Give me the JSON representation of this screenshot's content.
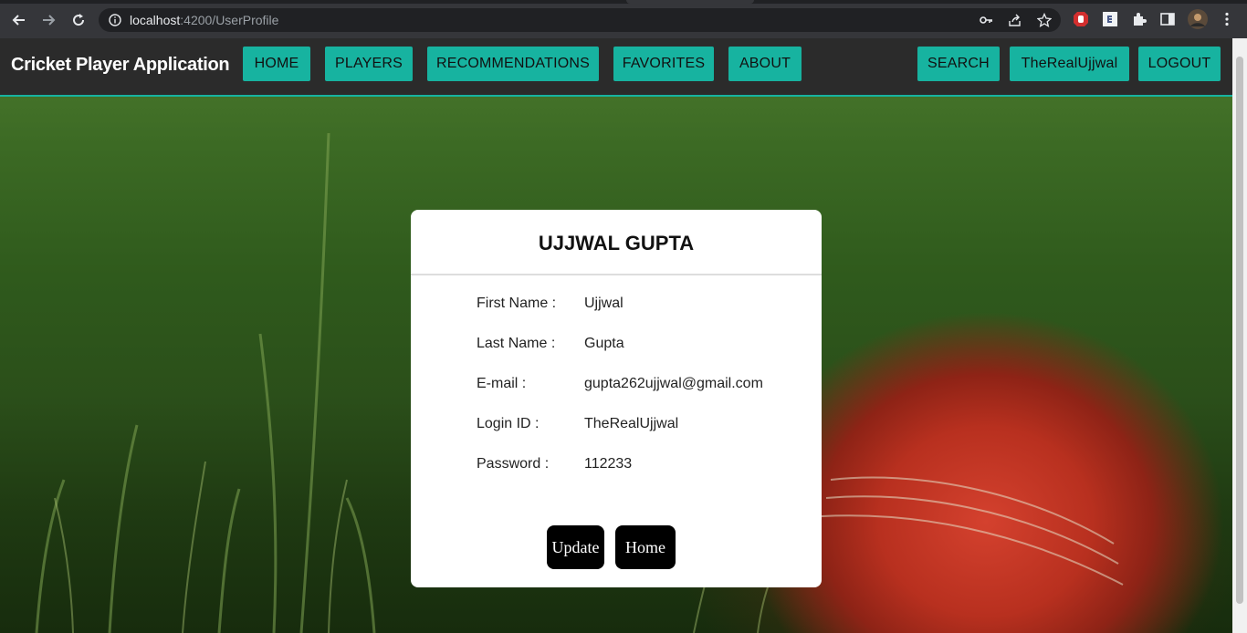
{
  "browser": {
    "url_host": "localhost",
    "url_path": ":4200/UserProfile"
  },
  "navbar": {
    "brand": "Cricket Player Application",
    "links": [
      "HOME",
      "PLAYERS",
      "RECOMMENDATIONS",
      "FAVORITES",
      "ABOUT"
    ],
    "right_links": [
      "SEARCH",
      "TheRealUjjwal",
      "LOGOUT"
    ]
  },
  "profile": {
    "title": "UJJWAL GUPTA",
    "fields": [
      {
        "label": "First Name :",
        "value": "Ujjwal"
      },
      {
        "label": "Last Name :",
        "value": "Gupta"
      },
      {
        "label": "E-mail :",
        "value": "gupta262ujjwal@gmail.com"
      },
      {
        "label": "Login ID :",
        "value": "TheRealUjjwal"
      },
      {
        "label": "Password :",
        "value": "112233"
      }
    ],
    "update_label": "Update",
    "home_label": "Home"
  },
  "colors": {
    "accent": "#17b3a0",
    "navbar_bg": "#2b2b2b"
  }
}
